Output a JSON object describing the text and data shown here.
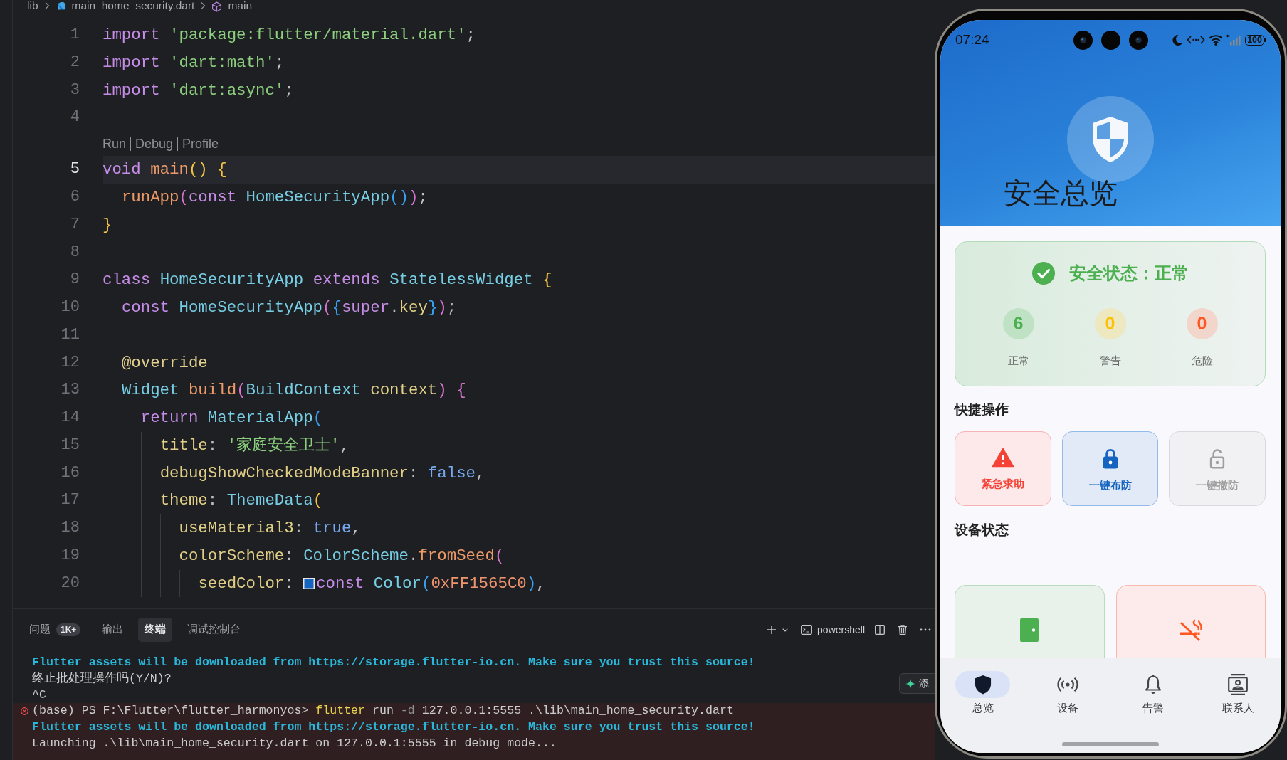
{
  "breadcrumb": [
    {
      "kind": "folder",
      "label": "lib"
    },
    {
      "kind": "file",
      "label": "main_home_security.dart"
    },
    {
      "kind": "symbol",
      "label": "main"
    }
  ],
  "editor": {
    "lines": [
      {
        "number": "1",
        "current": false,
        "tokens": [
          {
            "kind": "keyword",
            "text": "import "
          },
          {
            "kind": "string",
            "text": "'package:flutter/material.dart'"
          },
          {
            "kind": "plain",
            "text": ";"
          }
        ]
      },
      {
        "number": "2",
        "current": false,
        "tokens": [
          {
            "kind": "keyword",
            "text": "import "
          },
          {
            "kind": "string",
            "text": "'dart:math'"
          },
          {
            "kind": "plain",
            "text": ";"
          }
        ]
      },
      {
        "number": "3",
        "current": false,
        "tokens": [
          {
            "kind": "keyword",
            "text": "import "
          },
          {
            "kind": "string",
            "text": "'dart:async'"
          },
          {
            "kind": "plain",
            "text": ";"
          }
        ]
      },
      {
        "number": "4",
        "current": false
      },
      {
        "number": "5",
        "current": true,
        "lens": [
          "Run",
          "Debug",
          "Profile"
        ],
        "tokens": [
          {
            "kind": "keyword",
            "text": "void "
          },
          {
            "kind": "function",
            "text": "main"
          },
          {
            "kind": "paren1",
            "text": "() {"
          }
        ],
        "children": [
          {
            "number": "6",
            "current": false,
            "tokens": [
              {
                "kind": "function",
                "text": "runApp"
              },
              {
                "kind": "paren2",
                "text": "("
              },
              {
                "kind": "keyword",
                "text": "const "
              },
              {
                "kind": "type",
                "text": "HomeSecurityApp"
              },
              {
                "kind": "paren3",
                "text": "()"
              },
              {
                "kind": "paren2",
                "text": ")"
              },
              {
                "kind": "plain",
                "text": ";"
              }
            ]
          }
        ]
      },
      {
        "number": "7",
        "current": false,
        "tokens": [
          {
            "kind": "paren1",
            "text": "}"
          }
        ]
      },
      {
        "number": "8",
        "current": false
      },
      {
        "number": "9",
        "current": false,
        "tokens": [
          {
            "kind": "keyword",
            "text": "class "
          },
          {
            "kind": "type",
            "text": "HomeSecurityApp "
          },
          {
            "kind": "keyword",
            "text": "extends "
          },
          {
            "kind": "type",
            "text": "StatelessWidget "
          },
          {
            "kind": "paren1",
            "text": "{"
          }
        ],
        "children": [
          {
            "number": "10",
            "current": false,
            "tokens": [
              {
                "kind": "keyword",
                "text": "const "
              },
              {
                "kind": "type",
                "text": "HomeSecurityApp"
              },
              {
                "kind": "paren2",
                "text": "("
              },
              {
                "kind": "paren3",
                "text": "{"
              },
              {
                "kind": "keyword",
                "text": "super"
              },
              {
                "kind": "plain",
                "text": "."
              },
              {
                "kind": "field",
                "text": "key"
              },
              {
                "kind": "paren3",
                "text": "}"
              },
              {
                "kind": "paren2",
                "text": ")"
              },
              {
                "kind": "plain",
                "text": ";"
              }
            ]
          },
          {
            "number": "11",
            "current": false
          },
          {
            "number": "12",
            "current": false,
            "tokens": [
              {
                "kind": "annotation",
                "text": "@override"
              }
            ]
          },
          {
            "number": "13",
            "current": false,
            "tokens": [
              {
                "kind": "type",
                "text": "Widget "
              },
              {
                "kind": "function",
                "text": "build"
              },
              {
                "kind": "paren2",
                "text": "("
              },
              {
                "kind": "type",
                "text": "BuildContext "
              },
              {
                "kind": "field",
                "text": "context"
              },
              {
                "kind": "paren2",
                "text": ") {"
              }
            ],
            "children": [
              {
                "number": "14",
                "current": false,
                "tokens": [
                  {
                    "kind": "keyword",
                    "text": "return "
                  },
                  {
                    "kind": "type",
                    "text": "MaterialApp"
                  },
                  {
                    "kind": "paren3",
                    "text": "("
                  }
                ],
                "children": [
                  {
                    "number": "15",
                    "current": false,
                    "tokens": [
                      {
                        "kind": "field",
                        "text": "title"
                      },
                      {
                        "kind": "plain",
                        "text": ": "
                      },
                      {
                        "kind": "string",
                        "text": "'家庭安全卫士'"
                      },
                      {
                        "kind": "plain",
                        "text": ","
                      }
                    ]
                  },
                  {
                    "number": "16",
                    "current": false,
                    "tokens": [
                      {
                        "kind": "field",
                        "text": "debugShowCheckedModeBanner"
                      },
                      {
                        "kind": "plain",
                        "text": ": "
                      },
                      {
                        "kind": "literal",
                        "text": "false"
                      },
                      {
                        "kind": "plain",
                        "text": ","
                      }
                    ]
                  },
                  {
                    "number": "17",
                    "current": false,
                    "tokens": [
                      {
                        "kind": "field",
                        "text": "theme"
                      },
                      {
                        "kind": "plain",
                        "text": ": "
                      },
                      {
                        "kind": "type",
                        "text": "ThemeData"
                      },
                      {
                        "kind": "paren1",
                        "text": "("
                      }
                    ],
                    "children": [
                      {
                        "number": "18",
                        "current": false,
                        "tokens": [
                          {
                            "kind": "field",
                            "text": "useMaterial3"
                          },
                          {
                            "kind": "plain",
                            "text": ": "
                          },
                          {
                            "kind": "literal",
                            "text": "true"
                          },
                          {
                            "kind": "plain",
                            "text": ","
                          }
                        ]
                      },
                      {
                        "number": "19",
                        "current": false,
                        "tokens": [
                          {
                            "kind": "field",
                            "text": "colorScheme"
                          },
                          {
                            "kind": "plain",
                            "text": ": "
                          },
                          {
                            "kind": "type",
                            "text": "ColorScheme"
                          },
                          {
                            "kind": "plain",
                            "text": "."
                          },
                          {
                            "kind": "function",
                            "text": "fromSeed"
                          },
                          {
                            "kind": "paren2",
                            "text": "("
                          }
                        ],
                        "children": [
                          {
                            "number": "20",
                            "current": false,
                            "tokens": [
                              {
                                "kind": "field",
                                "text": "seedColor"
                              },
                              {
                                "kind": "plain",
                                "text": ": "
                              },
                              {
                                "kind": "swatch",
                                "color": "#1565c0"
                              },
                              {
                                "kind": "keyword",
                                "text": "const "
                              },
                              {
                                "kind": "type",
                                "text": "Color"
                              },
                              {
                                "kind": "paren3",
                                "text": "("
                              },
                              {
                                "kind": "number",
                                "text": "0xFF1565C0"
                              },
                              {
                                "kind": "paren3",
                                "text": ")"
                              },
                              {
                                "kind": "plain",
                                "text": ","
                              }
                            ]
                          }
                        ]
                      }
                    ]
                  }
                ]
              }
            ]
          }
        ]
      }
    ]
  },
  "panel": {
    "tabs": [
      {
        "label": "问题",
        "badge": "1K+",
        "selected": false
      },
      {
        "label": "输出",
        "selected": false
      },
      {
        "label": "终端",
        "selected": true
      },
      {
        "label": "调试控制台",
        "selected": false
      }
    ],
    "shell": "powershell",
    "assist_button": {
      "label": "添"
    },
    "terminal": {
      "lines": [
        {
          "segments": [
            {
              "kind": "info",
              "text": "Flutter assets will be downloaded from https://storage.flutter-io.cn. Make sure you trust this source!"
            }
          ]
        },
        {
          "segments": [
            {
              "kind": "plain",
              "text": "终止批处理操作吗(Y/N)?"
            }
          ]
        },
        {
          "segments": [
            {
              "kind": "plain",
              "text": "^C"
            }
          ]
        }
      ],
      "command": {
        "failed": true,
        "segments": [
          {
            "kind": "plain",
            "text": "(base) PS F:\\Flutter\\flutter_harmonyos> "
          },
          {
            "kind": "program",
            "text": "flutter"
          },
          {
            "kind": "plain",
            "text": " run "
          },
          {
            "kind": "flag",
            "text": "-d"
          },
          {
            "kind": "plain",
            "text": " 127.0.0.1:5555 .\\lib\\main_home_security.dart"
          }
        ],
        "output": [
          {
            "segments": [
              {
                "kind": "info",
                "text": "Flutter assets will be downloaded from https://storage.flutter-io.cn. Make sure you trust this source!"
              }
            ]
          },
          {
            "segments": [
              {
                "kind": "plain",
                "text": "Launching .\\lib\\main_home_security.dart on 127.0.0.1:5555 in debug mode..."
              }
            ]
          }
        ]
      }
    }
  },
  "phone": {
    "status_bar": {
      "time": "07:24",
      "battery": "100"
    },
    "title": "安全总览",
    "status_card": {
      "kind": "normal",
      "title": "安全状态：正常",
      "stats": [
        {
          "kind": "normal",
          "value": "6",
          "label": "正常"
        },
        {
          "kind": "warning",
          "value": "0",
          "label": "警告"
        },
        {
          "kind": "danger",
          "value": "0",
          "label": "危险"
        }
      ]
    },
    "quick_actions": {
      "title": "快捷操作",
      "items": [
        {
          "kind": "emergency",
          "label": "紧急求助"
        },
        {
          "kind": "arm",
          "label": "一键布防"
        },
        {
          "kind": "disarm",
          "label": "一键撤防"
        }
      ]
    },
    "devices": {
      "title": "设备状态",
      "items": [
        {
          "kind": "door",
          "alert": false
        },
        {
          "kind": "smoke",
          "alert": true
        }
      ]
    },
    "nav": [
      {
        "kind": "overview",
        "label": "总览",
        "selected": true
      },
      {
        "kind": "devices",
        "label": "设备",
        "selected": false
      },
      {
        "kind": "alerts",
        "label": "告警",
        "selected": false
      },
      {
        "kind": "contacts",
        "label": "联系人",
        "selected": false
      }
    ]
  }
}
